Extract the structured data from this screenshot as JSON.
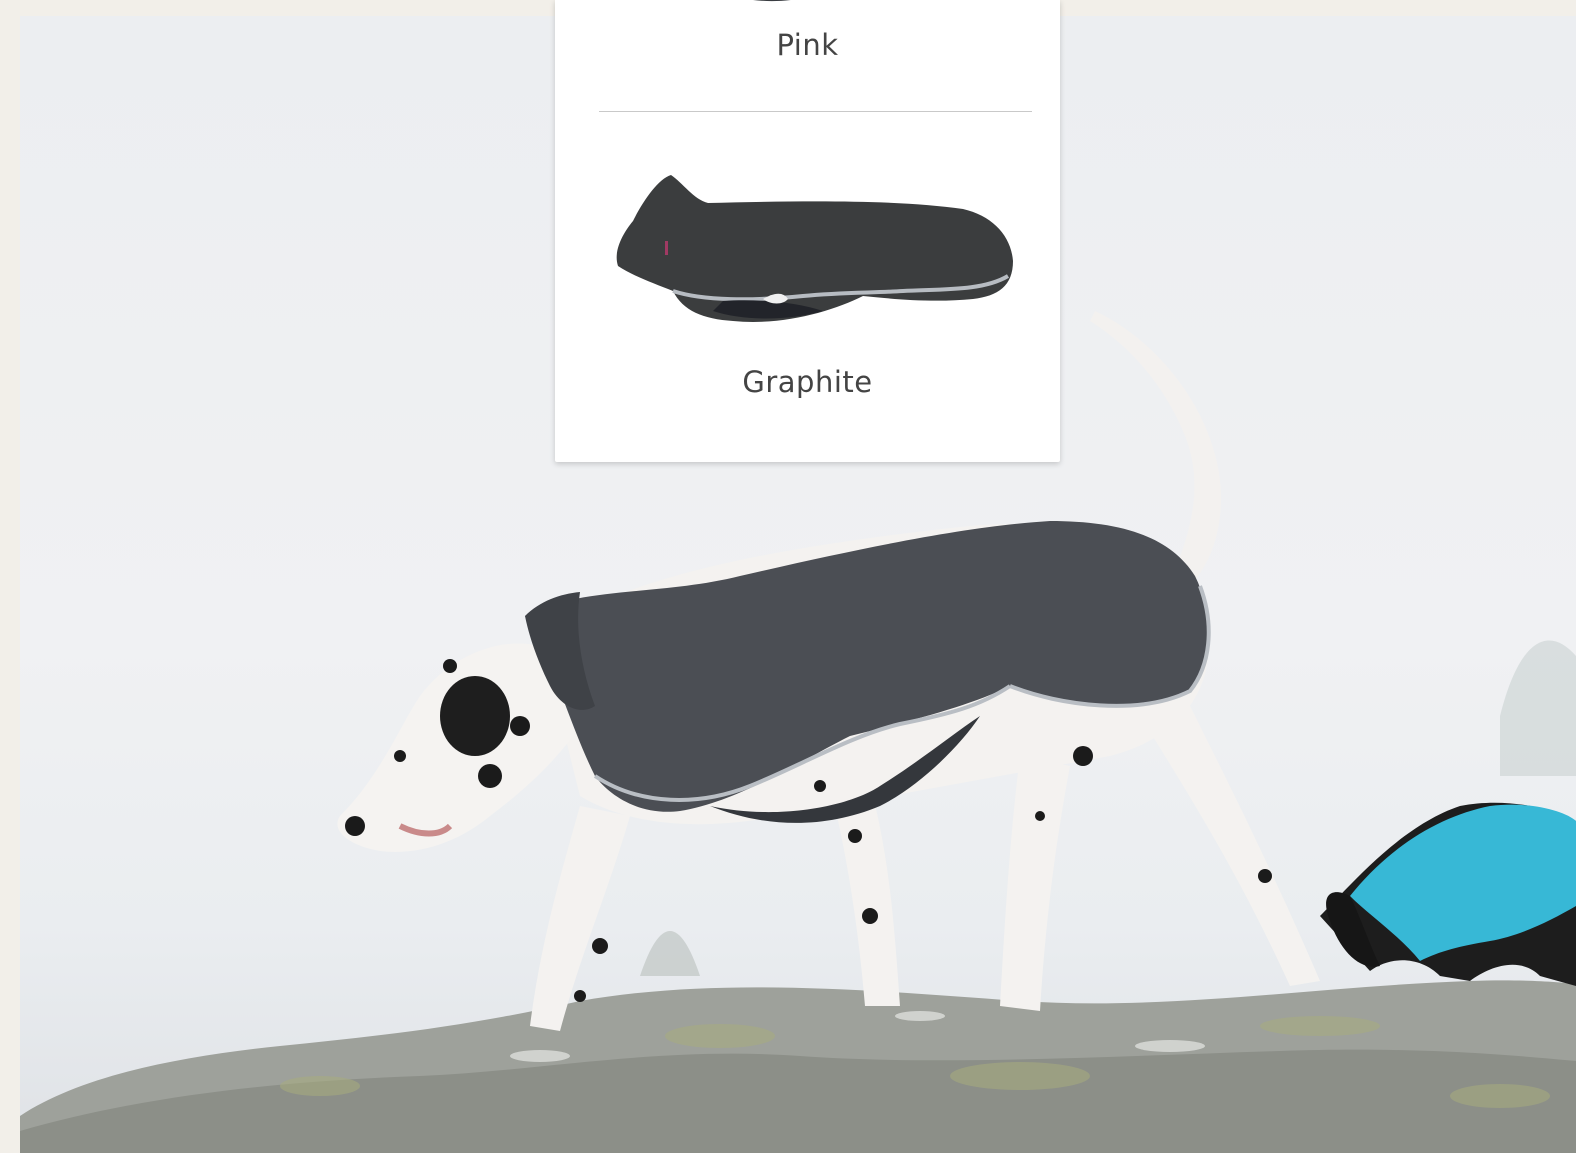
{
  "page": {
    "background_color": "#f2efe9"
  },
  "color_dropdown": {
    "options": [
      {
        "label": "Pink",
        "swatch_icon": "coat-thumbnail-icon"
      },
      {
        "label": "Graphite",
        "swatch_icon": "coat-thumbnail-icon"
      }
    ]
  },
  "hero_image": {
    "subject_icon": "dalmatian-in-graphite-coat-photo"
  }
}
